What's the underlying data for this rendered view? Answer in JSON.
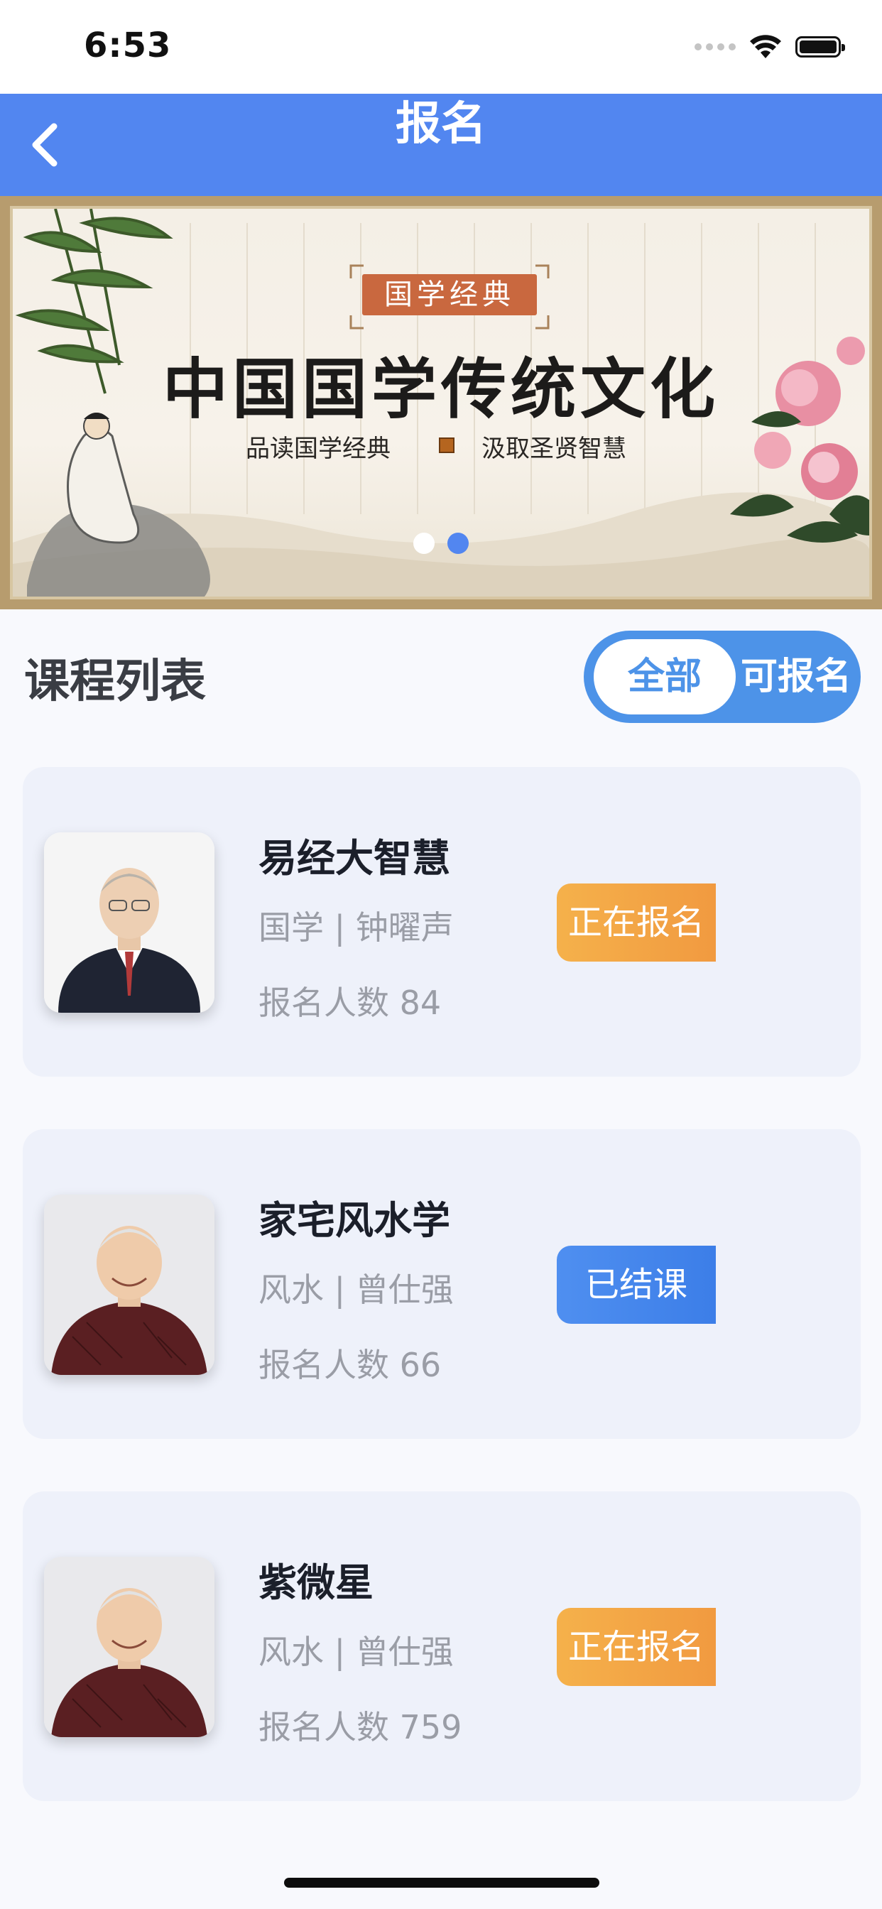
{
  "status_bar": {
    "time": "6:53"
  },
  "nav": {
    "title": "报名"
  },
  "banner": {
    "tag": "国学经典",
    "headline": "中国国学传统文化",
    "subtitle_left": "品读国学经典",
    "subtitle_right": "汲取圣贤智慧",
    "dots_active_index": 1
  },
  "section": {
    "title": "课程列表"
  },
  "filter": {
    "all_label": "全部",
    "open_label": "可报名",
    "selected": "全部"
  },
  "courses": [
    {
      "title": "易经大智慧",
      "meta": "国学 | 钟曜声",
      "count": "报名人数 84",
      "status": "正在报名",
      "status_color": "#f2a546"
    },
    {
      "title": "家宅风水学",
      "meta": "风水 | 曾仕强",
      "count": "报名人数 66",
      "status": "已结课",
      "status_color": "#4587ee"
    },
    {
      "title": "紫微星",
      "meta": "风水 | 曾仕强",
      "count": "报名人数 759",
      "status": "正在报名",
      "status_color": "#f2a546"
    }
  ],
  "colors": {
    "primary": "#5286f0",
    "card_bg": "#eef1fa",
    "accent_orange": "#f2a546"
  }
}
